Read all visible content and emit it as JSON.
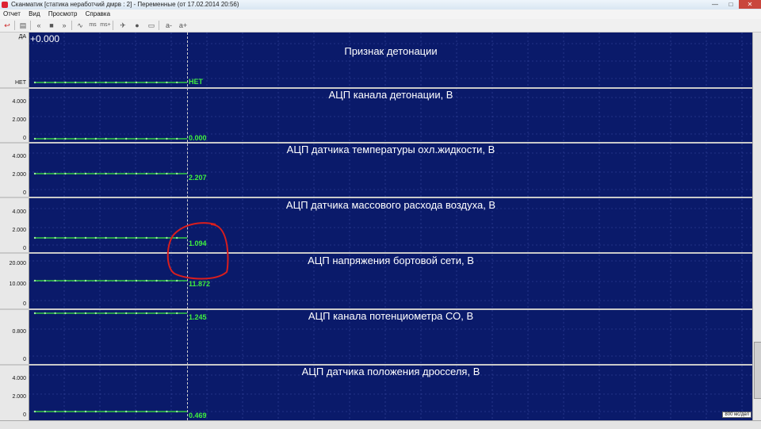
{
  "window": {
    "title": "Сканматик [статика неработчий дмрв : 2] - Переменные (от 17.02.2014  20:56)"
  },
  "menu": [
    "Отчет",
    "Вид",
    "Просмотр",
    "Справка"
  ],
  "toolbar_icons": [
    "arrow-back-icon",
    "clipboard-icon",
    "rewind-icon",
    "stop-icon",
    "forward-icon",
    "wave-icon",
    "ms-icon",
    "ms-plus-icon",
    "plane-icon",
    "record-icon",
    "bar-icon",
    "a-minus-icon",
    "a-plus-icon"
  ],
  "cursor_readout": "+0.000",
  "time_scale": "800 мс/дел",
  "accent_color": "#3ff03f",
  "background_color": "#0a1a6a",
  "annotation_color": "#d81e1e",
  "panels": [
    {
      "title": "Признак детонации",
      "ticks": [
        "ДА",
        "НЕТ"
      ],
      "value": "НЕТ"
    },
    {
      "title": "АЦП канала детонации, В",
      "ticks": [
        "4.000",
        "2.000",
        "0"
      ],
      "value": "0.000"
    },
    {
      "title": "АЦП датчика температуры охл.жидкости, В",
      "ticks": [
        "4.000",
        "2.000",
        "0"
      ],
      "value": "2.207"
    },
    {
      "title": "АЦП датчика массового расхода воздуха, В",
      "ticks": [
        "4.000",
        "2.000",
        "0"
      ],
      "value": "1.094"
    },
    {
      "title": "АЦП напряжения бортовой сети, В",
      "ticks": [
        "20.000",
        "10.000",
        "0"
      ],
      "value": "11.872"
    },
    {
      "title": "АЦП канала потенциометра СО, В",
      "ticks": [
        "0.800",
        "0"
      ],
      "value": "1.245"
    },
    {
      "title": "АЦП датчика положения дросселя, В",
      "ticks": [
        "4.000",
        "2.000",
        "0"
      ],
      "value": "0.469"
    }
  ]
}
